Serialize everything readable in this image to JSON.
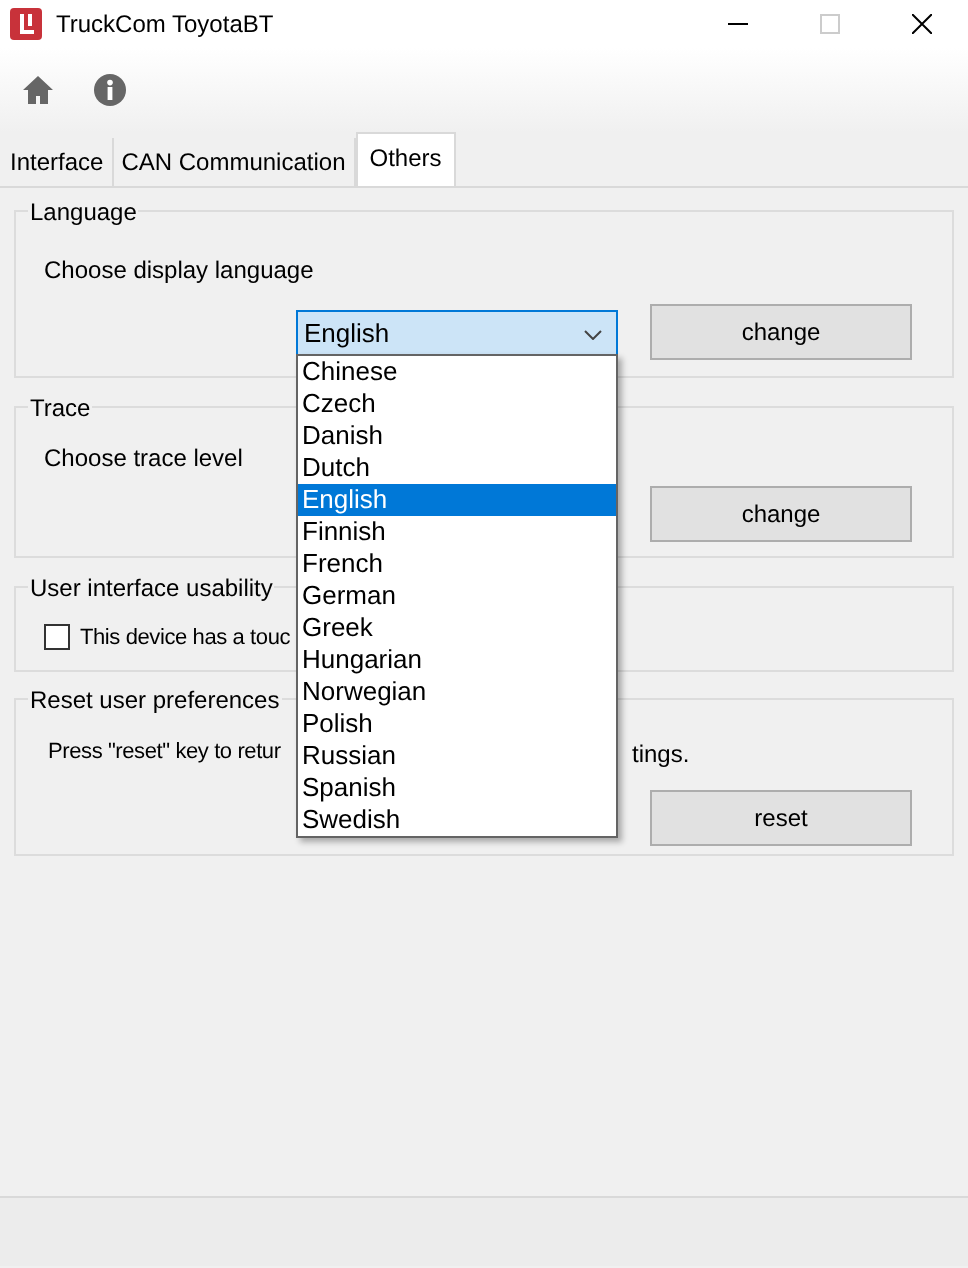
{
  "window": {
    "title": "TruckCom ToyotaBT"
  },
  "tabs": [
    {
      "label": "Interface",
      "selected": false
    },
    {
      "label": "CAN Communication",
      "selected": false
    },
    {
      "label": "Others",
      "selected": true
    }
  ],
  "language": {
    "title": "Language",
    "prompt": "Choose display language",
    "combo_value": "English",
    "button": "change",
    "options": [
      {
        "label": "Chinese",
        "selected": false
      },
      {
        "label": "Czech",
        "selected": false
      },
      {
        "label": "Danish",
        "selected": false
      },
      {
        "label": "Dutch",
        "selected": false
      },
      {
        "label": "English",
        "selected": true
      },
      {
        "label": "Finnish",
        "selected": false
      },
      {
        "label": "French",
        "selected": false
      },
      {
        "label": "German",
        "selected": false
      },
      {
        "label": "Greek",
        "selected": false
      },
      {
        "label": "Hungarian",
        "selected": false
      },
      {
        "label": "Norwegian",
        "selected": false
      },
      {
        "label": "Polish",
        "selected": false
      },
      {
        "label": "Russian",
        "selected": false
      },
      {
        "label": "Spanish",
        "selected": false
      },
      {
        "label": "Swedish",
        "selected": false
      }
    ]
  },
  "trace": {
    "title": "Trace",
    "prompt": "Choose trace level",
    "button": "change"
  },
  "usability": {
    "title": "User interface usability",
    "checkbox_label": "This device has a touc",
    "checked": false
  },
  "reset": {
    "title": "Reset user preferences",
    "prompt_start": "Press \"reset\" key to retur",
    "prompt_end": "tings.",
    "button": "reset"
  }
}
